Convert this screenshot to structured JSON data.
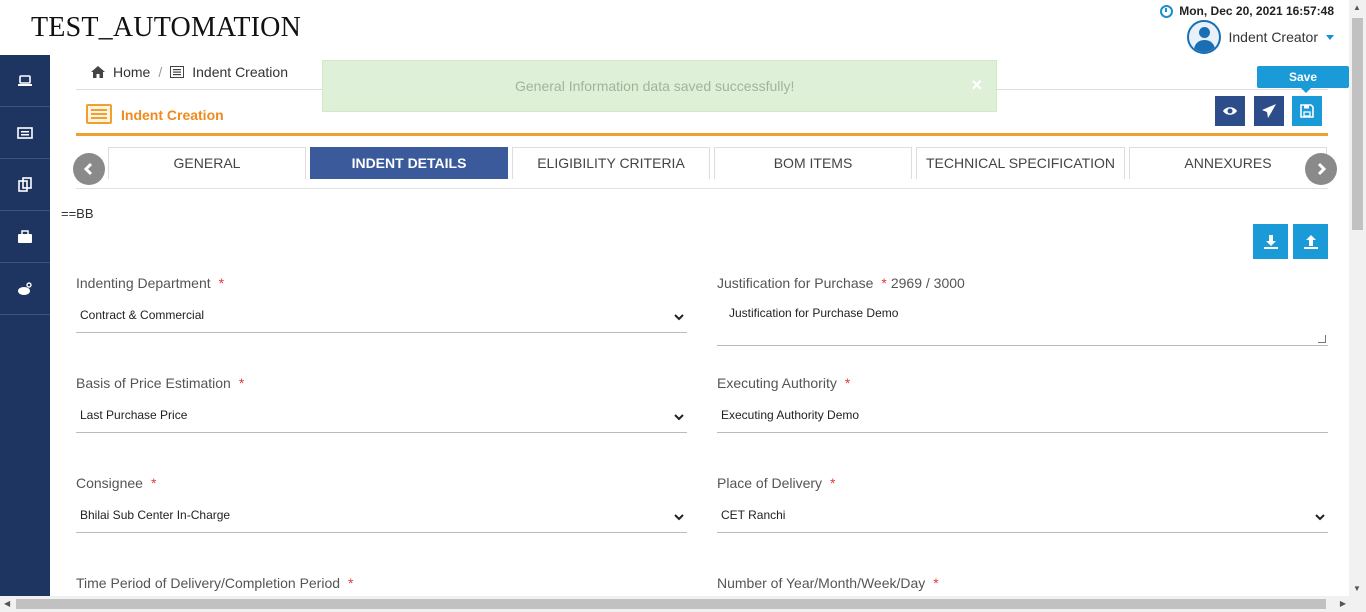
{
  "app": {
    "title": "TEST_AUTOMATION"
  },
  "header": {
    "datetime": "Mon, Dec 20, 2021 16:57:48",
    "user_role": "Indent Creator"
  },
  "sidebar": {
    "items": [
      {
        "icon": "laptop-icon"
      },
      {
        "icon": "list-icon"
      },
      {
        "icon": "copy-icon"
      },
      {
        "icon": "briefcase-icon"
      },
      {
        "icon": "weibo-icon"
      }
    ]
  },
  "breadcrumb": {
    "home": "Home",
    "separator": "/",
    "current": "Indent Creation"
  },
  "toast": {
    "message": "General Information data saved successfully!",
    "close": "×"
  },
  "page": {
    "title": "Indent Creation"
  },
  "actions": {
    "save_tooltip": "Save"
  },
  "tabs": [
    {
      "label": "GENERAL",
      "active": false
    },
    {
      "label": "INDENT DETAILS",
      "active": true
    },
    {
      "label": "ELIGIBILITY CRITERIA",
      "active": false
    },
    {
      "label": "BOM ITEMS",
      "active": false
    },
    {
      "label": "TECHNICAL SPECIFICATION",
      "active": false
    },
    {
      "label": "ANNEXURES",
      "active": false
    }
  ],
  "note": "==BB",
  "form": {
    "indenting_department": {
      "label": "Indenting Department",
      "required": "*",
      "value": "Contract & Commercial"
    },
    "justification": {
      "label": "Justification for Purchase",
      "required": "*",
      "counter": "2969 / 3000",
      "value": "Justification for Purchase Demo"
    },
    "basis_price": {
      "label": "Basis of Price Estimation",
      "required": "*",
      "value": "Last Purchase Price"
    },
    "executing_authority": {
      "label": "Executing Authority",
      "required": "*",
      "value": "Executing Authority Demo"
    },
    "consignee": {
      "label": "Consignee",
      "required": "*",
      "value": "Bhilai Sub Center In-Charge"
    },
    "place_delivery": {
      "label": "Place of Delivery",
      "required": "*",
      "value": "CET Ranchi"
    },
    "time_period": {
      "label": "Time Period of Delivery/Completion Period",
      "required": "*"
    },
    "number_period": {
      "label": "Number of Year/Month/Week/Day",
      "required": "*"
    }
  },
  "colors": {
    "sidebar": "#1e3461",
    "accent_orange": "#f08a1c",
    "active_tab": "#3a5a9c",
    "toast_bg": "#dff0d8",
    "primary_blue": "#1a9ad6"
  }
}
